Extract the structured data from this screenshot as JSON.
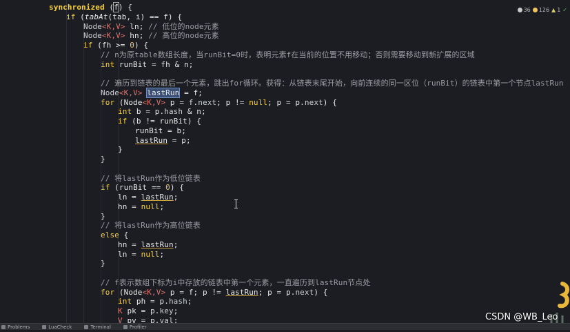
{
  "editor": {
    "lines": [
      {
        "segs": [
          {
            "t": "synchronized",
            "c": "kw bold"
          },
          {
            "t": " ("
          },
          {
            "t": "f",
            "c": "boxed"
          },
          {
            "t": ") {"
          }
        ]
      },
      {
        "segs": [
          {
            "t": "if",
            "c": "kw"
          },
          {
            "t": " ("
          },
          {
            "t": "tabAt",
            "c": "it"
          },
          {
            "t": "(tab, i) == f) {"
          }
        ]
      },
      {
        "segs": [
          {
            "t": "Node",
            "c": "ty"
          },
          {
            "t": "<",
            "c": "gen"
          },
          {
            "t": "K",
            "c": "gen"
          },
          {
            "t": ",",
            "c": "gen"
          },
          {
            "t": "V",
            "c": "gen"
          },
          {
            "t": ">",
            "c": "gen"
          },
          {
            "t": " ln; "
          },
          {
            "t": "// 低位的node元素",
            "c": "cm"
          }
        ]
      },
      {
        "segs": [
          {
            "t": "Node",
            "c": "ty"
          },
          {
            "t": "<",
            "c": "gen"
          },
          {
            "t": "K",
            "c": "gen"
          },
          {
            "t": ",",
            "c": "gen"
          },
          {
            "t": "V",
            "c": "gen"
          },
          {
            "t": ">",
            "c": "gen"
          },
          {
            "t": " hn; "
          },
          {
            "t": "// 高位的node元素",
            "c": "cm"
          }
        ]
      },
      {
        "segs": [
          {
            "t": "if",
            "c": "kw"
          },
          {
            "t": " (fh >= "
          },
          {
            "t": "0",
            "c": "nm"
          },
          {
            "t": ") {"
          }
        ]
      },
      {
        "segs": [
          {
            "t": "// n为原table数组长度，当runBit=0时，表明元素f在当前的位置不用移动；否则需要移动到新扩展的区域",
            "c": "cm"
          }
        ]
      },
      {
        "segs": [
          {
            "t": "int",
            "c": "kw"
          },
          {
            "t": " runBit = fh & n;"
          }
        ]
      },
      {
        "segs": [
          {
            "t": ""
          }
        ]
      },
      {
        "segs": [
          {
            "t": "// 遍历到链表的最后一个元素，跳出for循环。获得：从链表末尾开始，向前连续的同一区位（runBit）的链表中第一个节点lastRun",
            "c": "cm"
          }
        ]
      },
      {
        "segs": [
          {
            "t": "Node",
            "c": "ty"
          },
          {
            "t": "<",
            "c": "gen"
          },
          {
            "t": "K",
            "c": "gen"
          },
          {
            "t": ",",
            "c": "gen"
          },
          {
            "t": "V",
            "c": "gen"
          },
          {
            "t": ">",
            "c": "gen"
          },
          {
            "t": " "
          },
          {
            "t": "lastRun",
            "c": "sel"
          },
          {
            "t": " = f;"
          }
        ]
      },
      {
        "segs": [
          {
            "t": "for",
            "c": "kw"
          },
          {
            "t": " (Node"
          },
          {
            "t": "<",
            "c": "gen"
          },
          {
            "t": "K",
            "c": "gen"
          },
          {
            "t": ",",
            "c": "gen"
          },
          {
            "t": "V",
            "c": "gen"
          },
          {
            "t": ">",
            "c": "gen"
          },
          {
            "t": " p = f."
          },
          {
            "t": "next",
            "c": "ty"
          },
          {
            "t": "; p != "
          },
          {
            "t": "null",
            "c": "kw"
          },
          {
            "t": "; p = p."
          },
          {
            "t": "next",
            "c": "ty"
          },
          {
            "t": ") {"
          }
        ]
      },
      {
        "segs": [
          {
            "t": "int",
            "c": "kw"
          },
          {
            "t": " b = p."
          },
          {
            "t": "hash",
            "c": "ty"
          },
          {
            "t": " & n;"
          }
        ]
      },
      {
        "segs": [
          {
            "t": "if",
            "c": "kw"
          },
          {
            "t": " (b != runBit) {"
          }
        ]
      },
      {
        "segs": [
          {
            "t": "runBit = b;"
          }
        ]
      },
      {
        "segs": [
          {
            "t": "lastRun",
            "c": "strikeline"
          },
          {
            "t": " = p;"
          }
        ]
      },
      {
        "segs": [
          {
            "t": "}"
          }
        ]
      },
      {
        "segs": [
          {
            "t": "}"
          }
        ]
      },
      {
        "segs": [
          {
            "t": ""
          }
        ]
      },
      {
        "segs": [
          {
            "t": "// 将lastRun作为低位链表",
            "c": "cm"
          }
        ]
      },
      {
        "segs": [
          {
            "t": "if",
            "c": "kw"
          },
          {
            "t": " (runBit == "
          },
          {
            "t": "0",
            "c": "nm"
          },
          {
            "t": ") {"
          }
        ]
      },
      {
        "segs": [
          {
            "t": "ln = "
          },
          {
            "t": "lastRun",
            "c": "strikeline"
          },
          {
            "t": ";"
          }
        ]
      },
      {
        "segs": [
          {
            "t": "hn = "
          },
          {
            "t": "null",
            "c": "kw"
          },
          {
            "t": ";"
          }
        ]
      },
      {
        "segs": [
          {
            "t": "}"
          }
        ]
      },
      {
        "segs": [
          {
            "t": "// 将lastRun作为高位链表",
            "c": "cm"
          }
        ]
      },
      {
        "segs": [
          {
            "t": "else",
            "c": "kw"
          },
          {
            "t": " {"
          }
        ]
      },
      {
        "segs": [
          {
            "t": "hn = "
          },
          {
            "t": "lastRun",
            "c": "strikeline"
          },
          {
            "t": ";"
          }
        ]
      },
      {
        "segs": [
          {
            "t": "ln = "
          },
          {
            "t": "null",
            "c": "kw"
          },
          {
            "t": ";"
          }
        ]
      },
      {
        "segs": [
          {
            "t": "}"
          }
        ]
      },
      {
        "segs": [
          {
            "t": ""
          }
        ]
      },
      {
        "segs": [
          {
            "t": "// f表示数组下标为i中存放的链表中第一个元素，一直遍历到lastRun节点处",
            "c": "cm"
          }
        ]
      },
      {
        "segs": [
          {
            "t": "for",
            "c": "kw"
          },
          {
            "t": " (Node"
          },
          {
            "t": "<",
            "c": "gen"
          },
          {
            "t": "K",
            "c": "gen"
          },
          {
            "t": ",",
            "c": "gen"
          },
          {
            "t": "V",
            "c": "gen"
          },
          {
            "t": ">",
            "c": "gen"
          },
          {
            "t": " p = f; p != "
          },
          {
            "t": "lastRun",
            "c": "strikeline"
          },
          {
            "t": "; p = p."
          },
          {
            "t": "next",
            "c": "ty"
          },
          {
            "t": ") {"
          }
        ]
      },
      {
        "segs": [
          {
            "t": "int",
            "c": "kw"
          },
          {
            "t": " ph = p."
          },
          {
            "t": "hash",
            "c": "ty"
          },
          {
            "t": ";"
          }
        ]
      },
      {
        "segs": [
          {
            "t": "K",
            "c": "gen"
          },
          {
            "t": " pk = p."
          },
          {
            "t": "key",
            "c": "ty"
          },
          {
            "t": ";"
          }
        ]
      },
      {
        "segs": [
          {
            "t": "V",
            "c": "gen"
          },
          {
            "t": " pv = p."
          },
          {
            "t": "val",
            "c": "ty"
          },
          {
            "t": ";"
          }
        ]
      }
    ]
  },
  "inspections": {
    "errors": "36",
    "warnings": "126",
    "typos": "1",
    "colors": {
      "error": "#c9c9c9",
      "warning": "#f2c55c",
      "ok": "#5fb85f"
    }
  },
  "statusbar": {
    "tools": [
      {
        "label": "Problems",
        "icon": "problems-icon"
      },
      {
        "label": "LuaCheck",
        "icon": "luacheck-icon"
      },
      {
        "label": "Terminal",
        "icon": "terminal-icon"
      },
      {
        "label": "Profiler",
        "icon": "profiler-icon"
      }
    ]
  },
  "watermark": "CSDN @WB_Leo"
}
